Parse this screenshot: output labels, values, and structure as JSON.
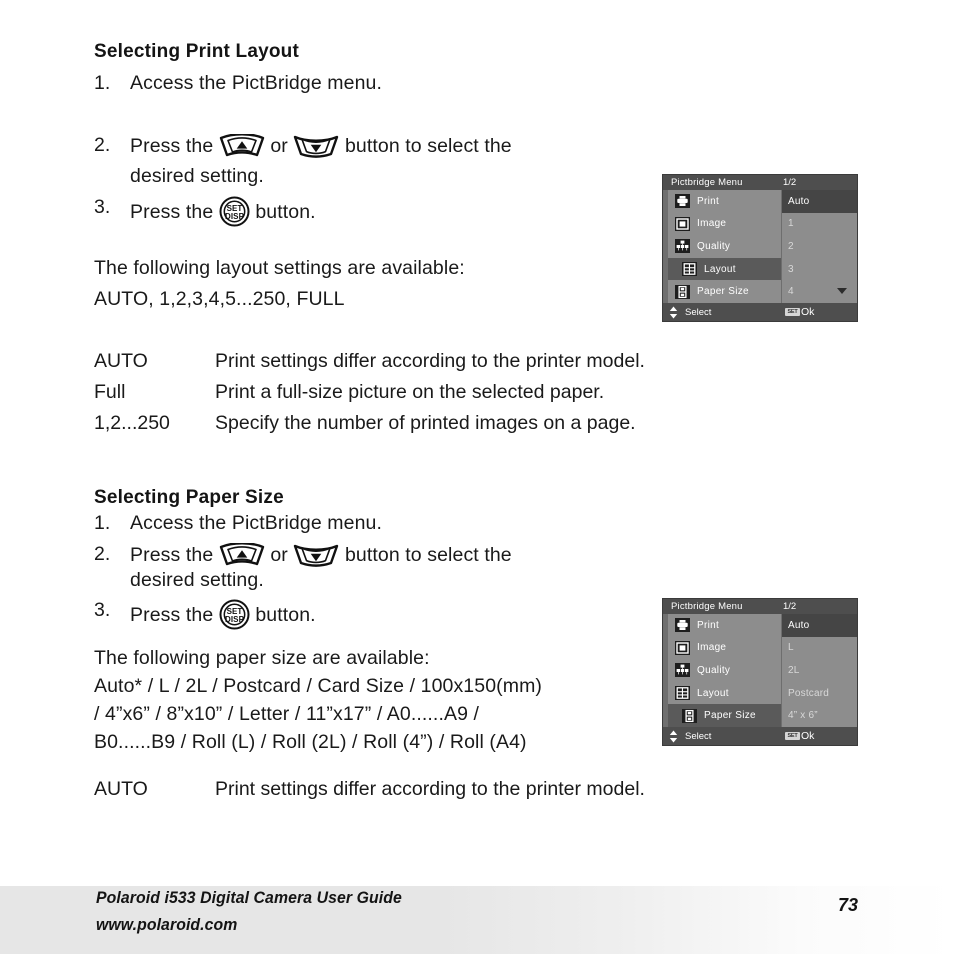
{
  "document": {
    "sections": [
      {
        "id": "print-layout",
        "title": "Selecting Print Layout",
        "steps": [
          {
            "num": "1.",
            "pre": "Access the PictBridge menu.",
            "post": "",
            "tail": ""
          },
          {
            "num": "2.",
            "pre": "Press the",
            "mid": "or",
            "post": "button to select the",
            "cont": "desired setting."
          },
          {
            "num": "3.",
            "pre": "Press the",
            "post": "button."
          }
        ],
        "intro": "The following layout settings are available:",
        "options": "AUTO, 1,2,3,4,5...250, FULL",
        "definitions": [
          {
            "term": "AUTO",
            "text": "Print settings differ according to the printer model."
          },
          {
            "term": "Full",
            "text": "Print a full-size picture on the selected paper."
          },
          {
            "term": "1,2...250",
            "text": "Specify the number of printed images on a page."
          }
        ]
      },
      {
        "id": "paper-size",
        "title": "Selecting Paper Size",
        "steps": [
          {
            "num": "1.",
            "pre": "Access the PictBridge menu.",
            "post": "",
            "tail": ""
          },
          {
            "num": "2.",
            "pre": "Press the",
            "mid": "or",
            "post": "button to select the",
            "cont": "desired setting."
          },
          {
            "num": "3.",
            "pre": "Press the",
            "post": "button."
          }
        ],
        "intro": "The following paper size are available:",
        "options_lines": [
          "Auto* / L / 2L / Postcard / Card Size / 100x150(mm)",
          "/ 4”x6” / 8”x10” / Letter / 11”x17” / A0......A9 /",
          "B0......B9 / Roll (L) / Roll (2L) / Roll (4”) / Roll (A4)"
        ],
        "definitions": [
          {
            "term": "AUTO",
            "text": "Print settings differ according to the printer model."
          }
        ]
      }
    ]
  },
  "lcd_layout": {
    "header": {
      "title": "Pictbridge Menu",
      "page": "1/2"
    },
    "items": [
      {
        "icon": "printer-icon",
        "label": "Print",
        "selected": false
      },
      {
        "icon": "image-icon",
        "label": "Image",
        "selected": false
      },
      {
        "icon": "quality-icon",
        "label": "Quality",
        "selected": false
      },
      {
        "icon": "layout-icon",
        "label": "Layout",
        "selected": true
      },
      {
        "icon": "paper-size-icon",
        "label": "Paper Size",
        "selected": false
      }
    ],
    "values": [
      {
        "text": "Auto",
        "selected": true
      },
      {
        "text": "1",
        "selected": false
      },
      {
        "text": "2",
        "selected": false
      },
      {
        "text": "3",
        "selected": false
      },
      {
        "text": "4",
        "selected": false
      }
    ],
    "has_scroll_down": true,
    "footer": {
      "select_label": "Select",
      "set_badge": "SET",
      "ok_label": "Ok"
    }
  },
  "lcd_paper": {
    "header": {
      "title": "Pictbridge Menu",
      "page": "1/2"
    },
    "items": [
      {
        "icon": "printer-icon",
        "label": "Print",
        "selected": false
      },
      {
        "icon": "image-icon",
        "label": "Image",
        "selected": false
      },
      {
        "icon": "quality-icon",
        "label": "Quality",
        "selected": false
      },
      {
        "icon": "layout-icon",
        "label": "Layout",
        "selected": false
      },
      {
        "icon": "paper-size-icon",
        "label": "Paper Size",
        "selected": true
      }
    ],
    "values": [
      {
        "text": "Auto",
        "selected": true
      },
      {
        "text": "L",
        "selected": false
      },
      {
        "text": "2L",
        "selected": false
      },
      {
        "text": "Postcard",
        "selected": false
      },
      {
        "text": "4” x 6”",
        "selected": false
      }
    ],
    "has_scroll_down": false,
    "footer": {
      "select_label": "Select",
      "set_badge": "SET",
      "ok_label": "Ok"
    }
  },
  "icons": {
    "rocker_up": "rocker-up-button-icon",
    "rocker_down": "rocker-down-button-icon",
    "set_disp": "set-disp-button-icon",
    "set_disp_top": "SET",
    "set_disp_bottom": "DISP"
  },
  "footer": {
    "line1": "Polaroid i533 Digital Camera User Guide",
    "line2": "www.polaroid.com",
    "page_number": "73"
  },
  "colors": {
    "lcd_bg": "#8d8d8d",
    "lcd_bar": "#4e4e4e",
    "lcd_selected": "#5a5a5a",
    "lcd_value_selected": "#454545",
    "text": "#1a1a1a"
  }
}
